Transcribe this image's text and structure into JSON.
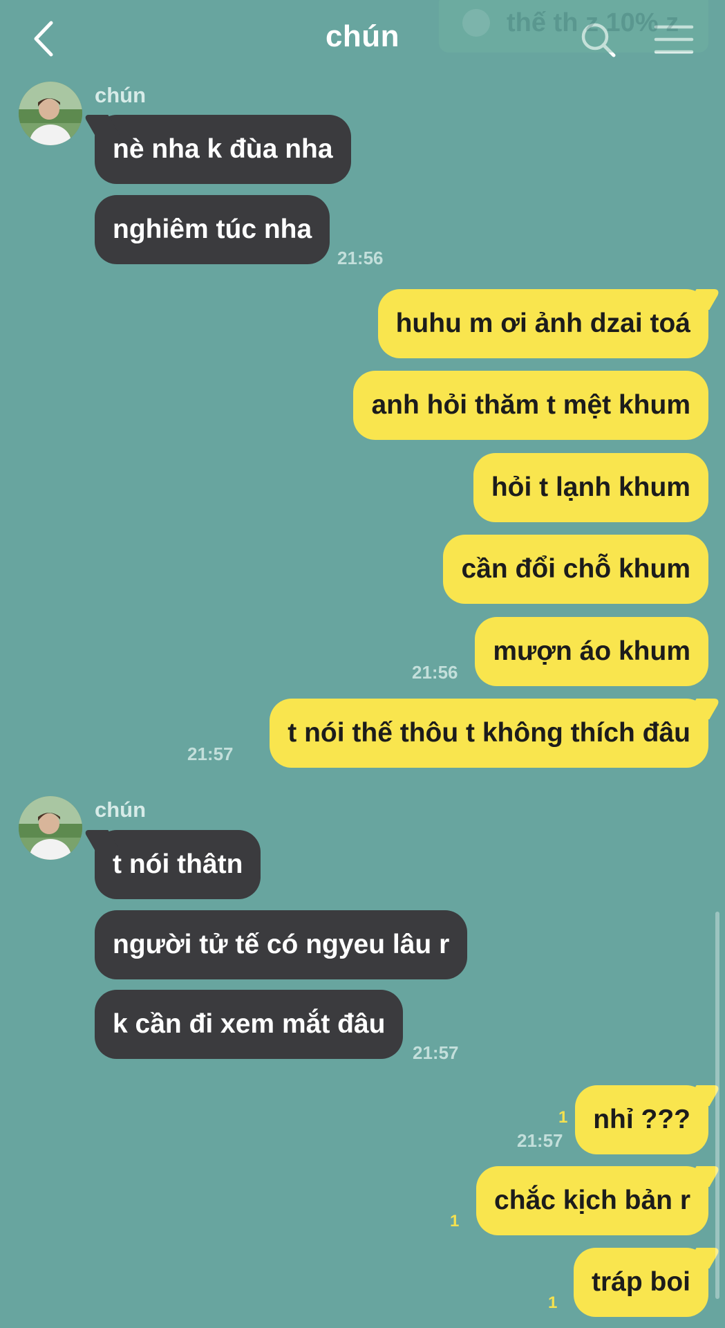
{
  "header": {
    "title": "chún",
    "back_icon": "chevron-left-icon",
    "search_icon": "search-icon",
    "menu_icon": "hamburger-menu-icon"
  },
  "notification_banner": {
    "text": "thế th z 10% z"
  },
  "colors": {
    "background": "#68a59f",
    "incoming_bubble": "#3b3b3e",
    "outgoing_bubble": "#f9e54e",
    "unread_badge": "#f4e14f"
  },
  "groups": [
    {
      "sender": "chún",
      "messages": [
        "nè nha k đùa nha",
        "nghiêm túc nha"
      ],
      "time": "21:56"
    },
    {
      "messages": [
        "huhu m ơi ảnh dzai toá",
        "anh hỏi thăm t mệt khum",
        "hỏi t lạnh khum",
        "cần đổi chỗ khum",
        "mượn áo khum"
      ],
      "time": "21:56"
    },
    {
      "messages": [
        "t nói thế thôu t không thích đâu"
      ],
      "time": "21:57"
    },
    {
      "sender": "chún",
      "messages": [
        "t nói thâtn",
        "người tử tế có ngyeu lâu r",
        "k cần đi xem mắt đâu"
      ],
      "time": "21:57"
    },
    {
      "messages": [
        "nhỉ ???"
      ],
      "time": "21:57",
      "unread": "1"
    },
    {
      "messages": [
        "chắc kịch bản r"
      ],
      "unread": "1"
    },
    {
      "messages": [
        "tráp boi"
      ],
      "unread": "1"
    }
  ]
}
